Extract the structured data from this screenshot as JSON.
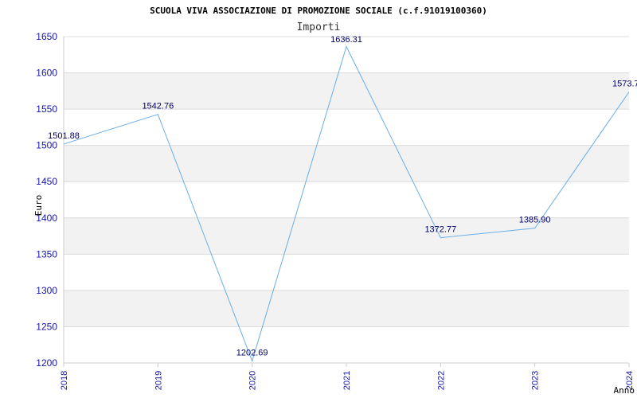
{
  "chart_data": {
    "type": "line",
    "title": "SCUOLA VIVA ASSOCIAZIONE DI PROMOZIONE SOCIALE (c.f.91019100360)",
    "subtitle": "Importi",
    "xlabel": "Anno",
    "ylabel": "Euro",
    "categories": [
      "2018",
      "2019",
      "2020",
      "2021",
      "2022",
      "2023",
      "2024"
    ],
    "series": [
      {
        "values": [
          1501.88,
          1542.76,
          1202.69,
          1636.31,
          1372.77,
          1385.9,
          1573.7
        ],
        "labels": [
          "1501.88",
          "1542.76",
          "1202.69",
          "1636.31",
          "1372.77",
          "1385.90",
          "1573.7"
        ]
      }
    ],
    "ylim": [
      1200,
      1650
    ],
    "yticks": [
      "1200",
      "1250",
      "1300",
      "1350",
      "1400",
      "1450",
      "1500",
      "1550",
      "1600",
      "1650"
    ],
    "grid": true,
    "colors": {
      "line": "#6aaee8",
      "band": "#f2f2f2",
      "tick_text": "#1515b0",
      "data_label": "#000066"
    }
  }
}
